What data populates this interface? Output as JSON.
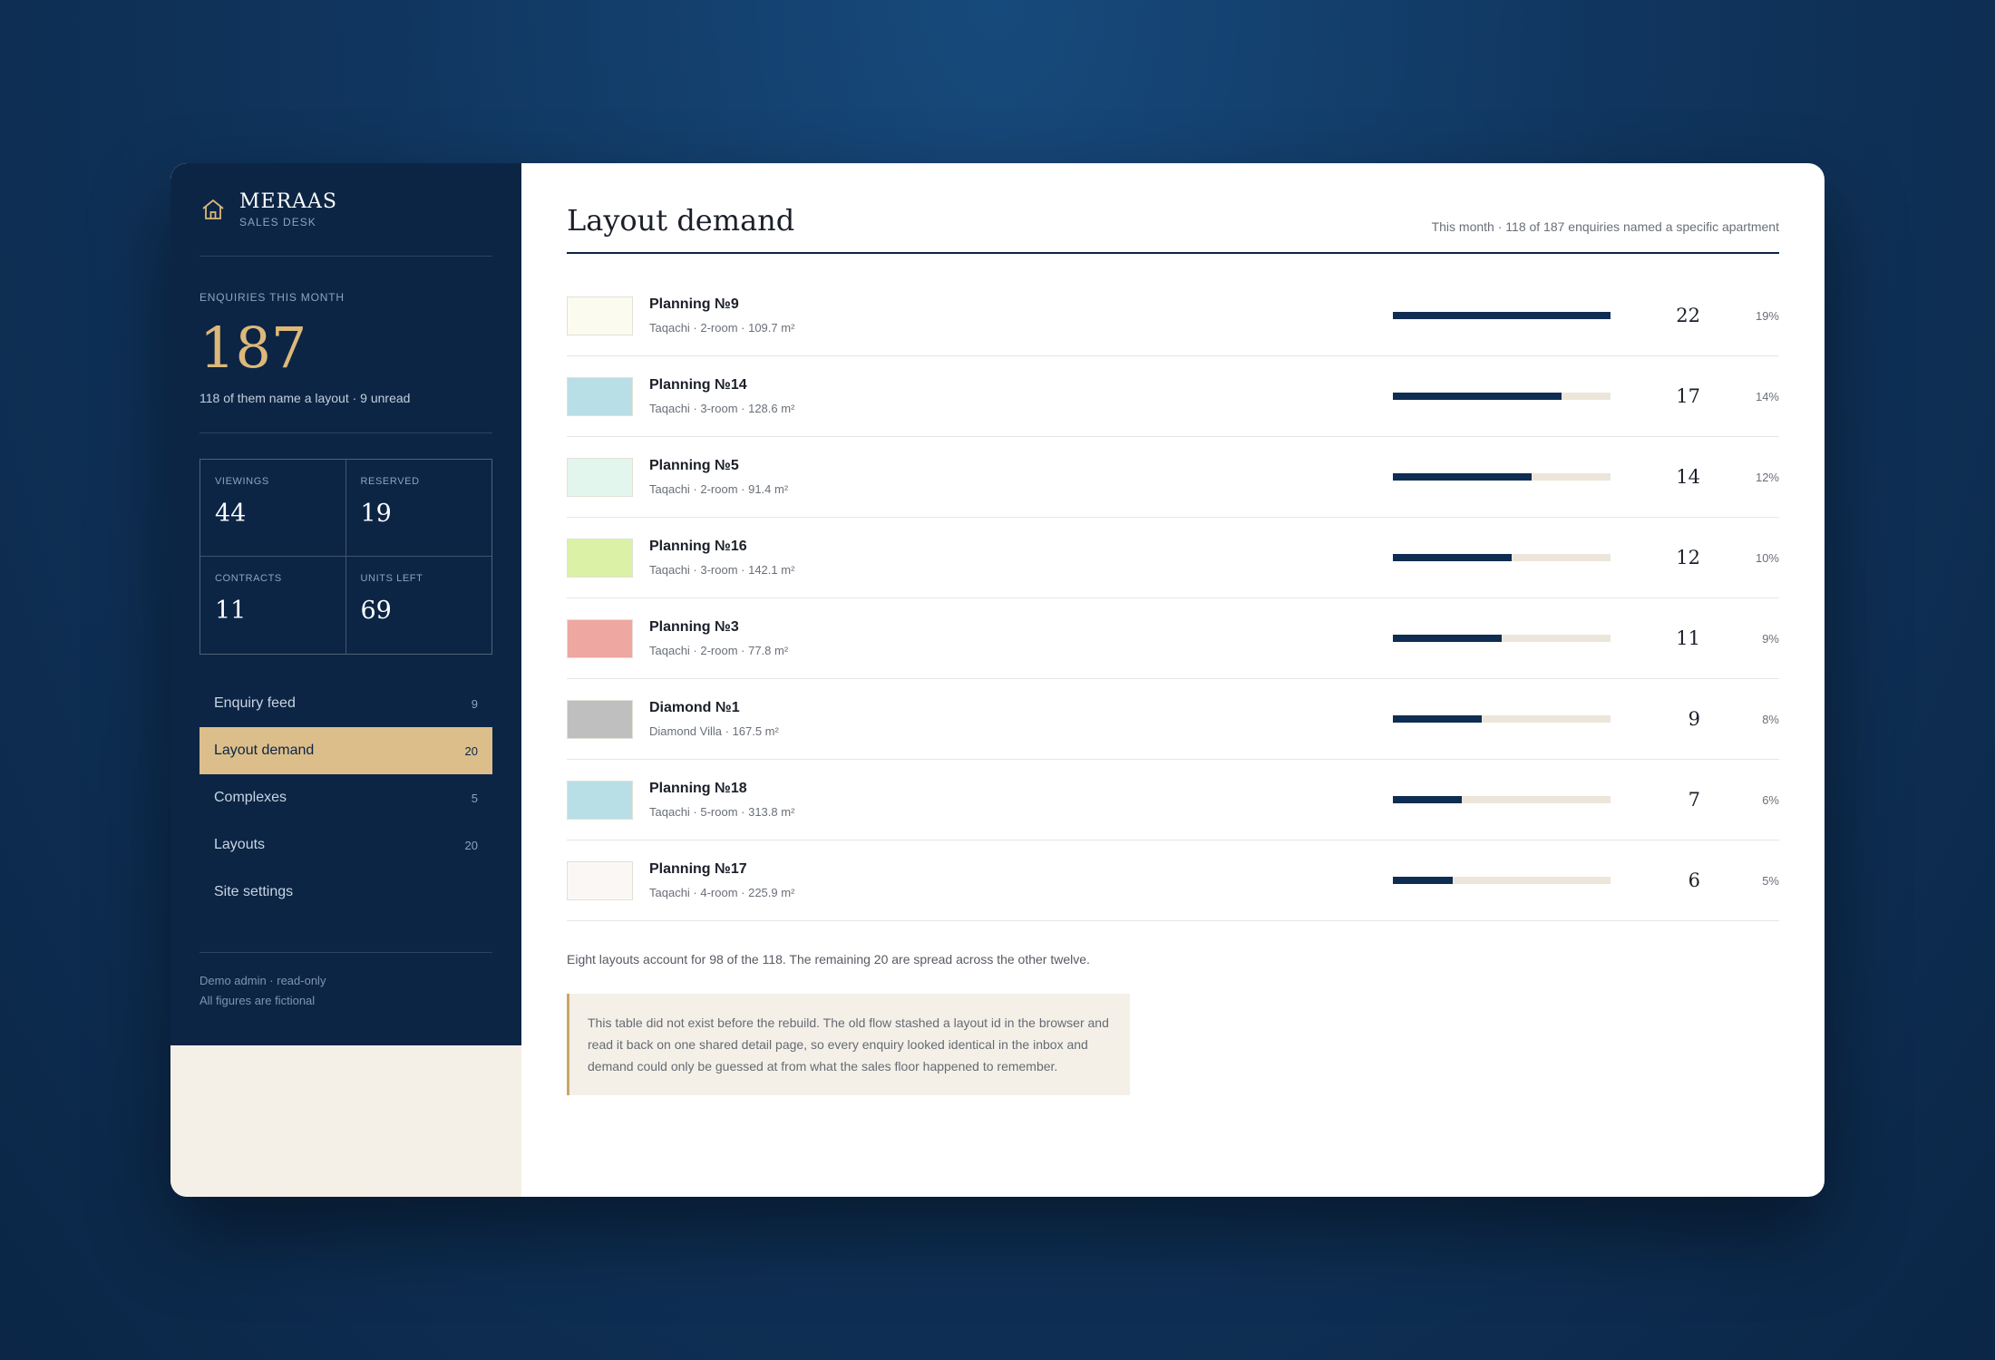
{
  "brand": {
    "name": "MERAAS",
    "subtitle": "SALES DESK"
  },
  "enquiries": {
    "label": "ENQUIRIES THIS MONTH",
    "total": "187",
    "note": "118 of them name a layout · 9 unread"
  },
  "stats": [
    {
      "label": "VIEWINGS",
      "value": "44"
    },
    {
      "label": "RESERVED",
      "value": "19"
    },
    {
      "label": "CONTRACTS",
      "value": "11"
    },
    {
      "label": "UNITS LEFT",
      "value": "69"
    }
  ],
  "nav": [
    {
      "label": "Enquiry feed",
      "count": "9"
    },
    {
      "label": "Layout demand",
      "count": "20"
    },
    {
      "label": "Complexes",
      "count": "5"
    },
    {
      "label": "Layouts",
      "count": "20"
    },
    {
      "label": "Site settings",
      "count": ""
    }
  ],
  "footer": {
    "line1": "Demo admin · read-only",
    "line2": "All figures are fictional"
  },
  "main": {
    "title": "Layout demand",
    "meta": "This month · 118 of 187 enquiries named a specific apartment",
    "summary": "Eight layouts account for 98 of the 118. The remaining 20 are spread across the other twelve.",
    "note": "This table did not exist before the rebuild. The old flow stashed a layout id in the browser and read it back on one shared detail page, so every enquiry looked identical in the inbox and demand could only be guessed at from what the sales floor happened to remember."
  },
  "layouts": [
    {
      "name": "Planning №9",
      "details": "Taqachi · 2-room · 109.7 m²",
      "count": "22",
      "pct": "19%",
      "share": 1.0,
      "swatch": "#fbfbef"
    },
    {
      "name": "Planning №14",
      "details": "Taqachi · 3-room · 128.6 m²",
      "count": "17",
      "pct": "14%",
      "share": 0.773,
      "swatch": "#b8dfe6"
    },
    {
      "name": "Planning №5",
      "details": "Taqachi · 2-room · 91.4 m²",
      "count": "14",
      "pct": "12%",
      "share": 0.636,
      "swatch": "#e3f6ee"
    },
    {
      "name": "Planning №16",
      "details": "Taqachi · 3-room · 142.1 m²",
      "count": "12",
      "pct": "10%",
      "share": 0.545,
      "swatch": "#daf1a6"
    },
    {
      "name": "Planning №3",
      "details": "Taqachi · 2-room · 77.8 m²",
      "count": "11",
      "pct": "9%",
      "share": 0.5,
      "swatch": "#efa7a2"
    },
    {
      "name": "Diamond №1",
      "details": "Diamond Villa · 167.5 m²",
      "count": "9",
      "pct": "8%",
      "share": 0.409,
      "swatch": "#bfbfbf"
    },
    {
      "name": "Planning №18",
      "details": "Taqachi · 5-room · 313.8 m²",
      "count": "7",
      "pct": "6%",
      "share": 0.318,
      "swatch": "#b8dfe6"
    },
    {
      "name": "Planning №17",
      "details": "Taqachi · 4-room · 225.9 m²",
      "count": "6",
      "pct": "5%",
      "share": 0.273,
      "swatch": "#fbf7f5"
    }
  ]
}
